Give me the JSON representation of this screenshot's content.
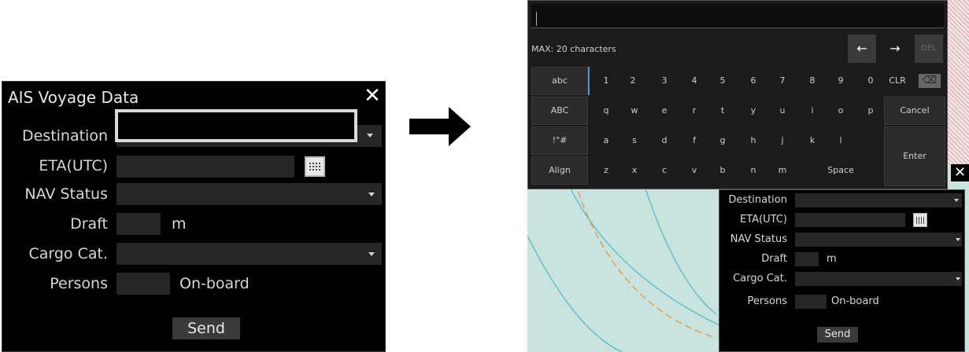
{
  "left_dialog": {
    "title": "AIS Voyage Data",
    "labels": {
      "destination": "Destination",
      "eta": "ETA(UTC)",
      "nav_status": "NAV Status",
      "draft": "Draft",
      "cargo": "Cargo Cat.",
      "persons": "Persons"
    },
    "draft_unit": "m",
    "persons_unit": "On-board",
    "send_label": "Send"
  },
  "keyboard": {
    "max_hint": "MAX: 20 characters",
    "left_arrow": "←",
    "right_arrow": "→",
    "del_label": "DEL",
    "modes": [
      "abc",
      "ABC",
      "!\"#",
      "Align"
    ],
    "row1": [
      "1",
      "2",
      "3",
      "4",
      "5",
      "6",
      "7",
      "8",
      "9",
      "0"
    ],
    "row2": [
      "q",
      "w",
      "e",
      "r",
      "t",
      "y",
      "u",
      "i",
      "o",
      "p"
    ],
    "row3": [
      "a",
      "s",
      "d",
      "f",
      "g",
      "h",
      "j",
      "k",
      "l"
    ],
    "row4": [
      "z",
      "x",
      "c",
      "v",
      "b",
      "n",
      "m"
    ],
    "space_label": "Space",
    "clr_label": "CLR",
    "backspace_glyph": "⌫",
    "cancel_label": "Cancel",
    "enter_label": "Enter"
  },
  "right_dialog": {
    "labels": {
      "destination": "Destination",
      "eta": "ETA(UTC)",
      "nav_status": "NAV Status",
      "draft": "Draft",
      "cargo": "Cargo Cat.",
      "persons": "Persons"
    },
    "draft_unit": "m",
    "persons_unit": "On-board",
    "send_label": "Send"
  },
  "icons": {
    "close": "✕",
    "arrow": "right-arrow-icon",
    "calendar": "calendar-icon"
  },
  "colors": {
    "dialog_bg": "#000000",
    "field_bg": "#262626",
    "map_sea": "#c9e4df",
    "contour_cyan": "#4fb8c8",
    "contour_orange": "#e8902a",
    "highlight_border": "#d9d9d9",
    "keyboard_bg": "#1b1b1b"
  }
}
